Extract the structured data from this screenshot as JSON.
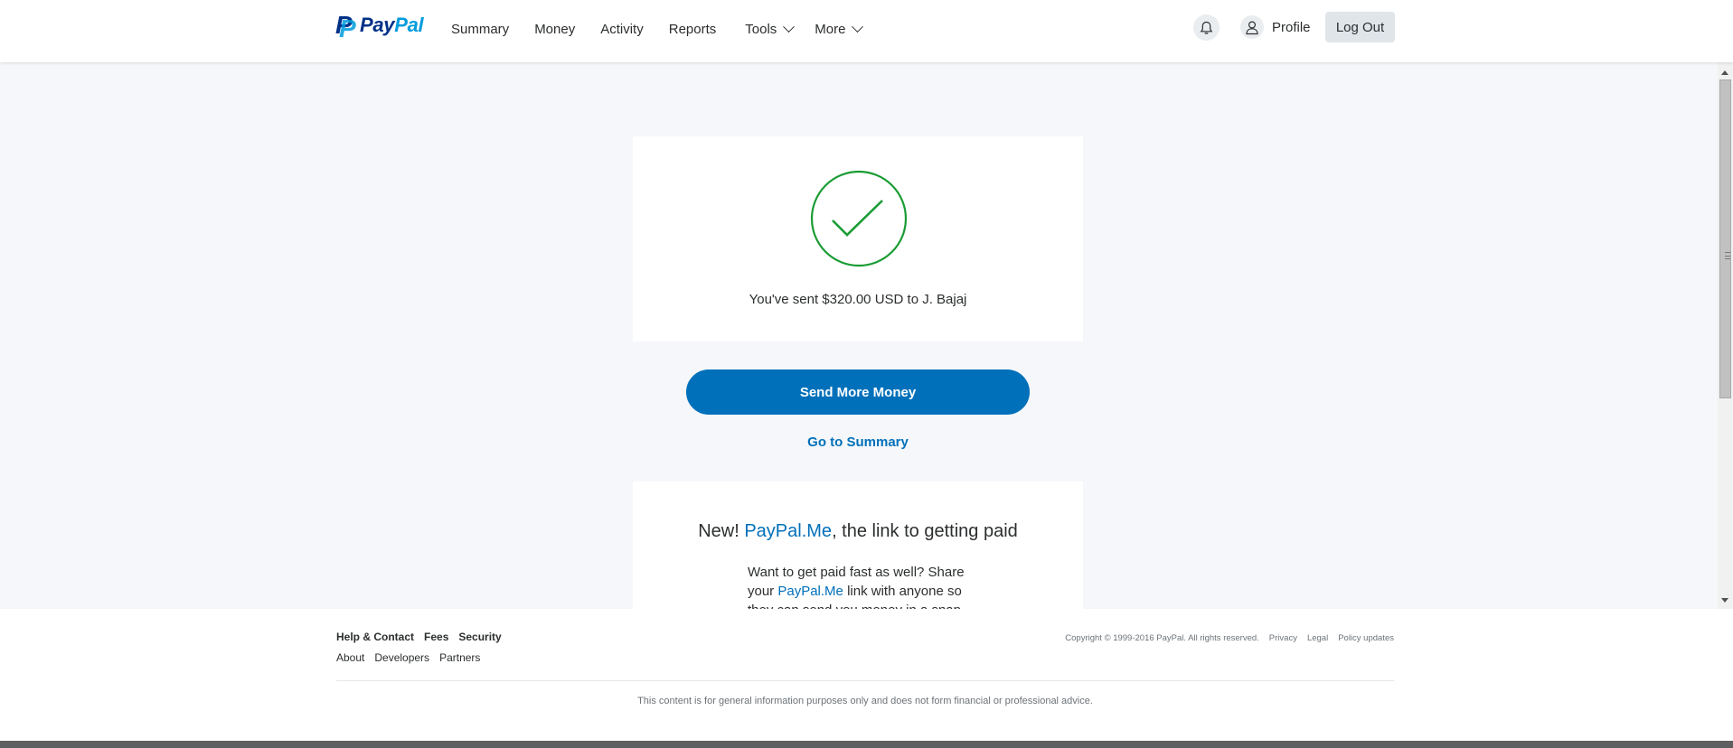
{
  "header": {
    "logo_text_pay": "Pay",
    "logo_text_pal": "Pal",
    "nav": [
      {
        "label": "Summary"
      },
      {
        "label": "Money"
      },
      {
        "label": "Activity"
      },
      {
        "label": "Reports"
      },
      {
        "label": "Tools",
        "dropdown": true
      },
      {
        "label": "More",
        "dropdown": true
      }
    ],
    "notification_icon": "bell-icon",
    "profile_label": "Profile",
    "logout_label": "Log Out"
  },
  "success": {
    "icon": "check-circle-icon",
    "message": "You've sent $320.00 USD to J. Bajaj",
    "check_color": "#1a9c34"
  },
  "actions": {
    "send_more_label": "Send More Money",
    "go_summary_label": "Go to Summary"
  },
  "promo": {
    "title_prefix": "New! ",
    "title_link": "PayPal.Me",
    "title_suffix": ", the link to getting paid",
    "text_1": "Want to get paid fast as well? Share your ",
    "text_link": "PayPal.Me",
    "text_2": " link with anyone so they can send you money in a snap."
  },
  "footer": {
    "links_primary": [
      "Help & Contact",
      "Fees",
      "Security"
    ],
    "links_secondary": [
      "About",
      "Developers",
      "Partners"
    ],
    "copyright": "Copyright © 1999-2016 PayPal. All rights reserved.",
    "legal_links": [
      "Privacy",
      "Legal",
      "Policy updates"
    ],
    "disclaimer": "This content is for general information purposes only and does not form financial or professional advice."
  },
  "colors": {
    "brand_blue": "#0070ba",
    "brand_dark": "#003087",
    "brand_light": "#009cde",
    "background": "#f5f7fa"
  }
}
